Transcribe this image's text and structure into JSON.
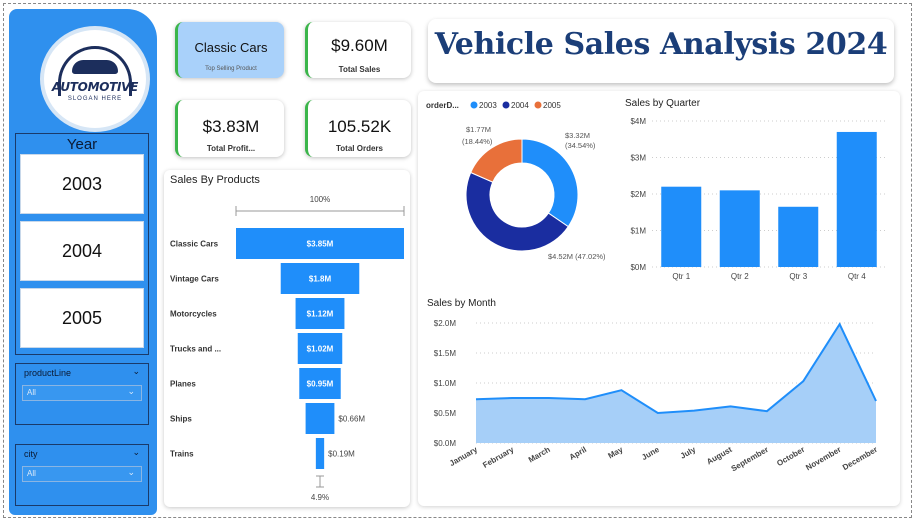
{
  "sidebar": {
    "logo": {
      "name": "AUTOMOTIVE",
      "slogan": "SLOGAN HERE"
    },
    "year_slicer": {
      "title": "Year",
      "options": [
        "2003",
        "2004",
        "2005"
      ]
    },
    "product_slicer": {
      "label": "productLine",
      "value": "All"
    },
    "city_slicer": {
      "label": "city",
      "value": "All"
    }
  },
  "kpis": {
    "top_product": {
      "value": "Classic Cars",
      "label": "Top Selling Product"
    },
    "total_sales": {
      "value": "$9.60M",
      "label": "Total Sales"
    },
    "total_profit": {
      "value": "$3.83M",
      "label": "Total Profit..."
    },
    "total_orders": {
      "value": "105.52K",
      "label": "Total Orders"
    }
  },
  "report": {
    "title": "Vehicle Sales Analysis 2024"
  },
  "colors": {
    "primary": "#1f8efa",
    "navy": "#1a2da0",
    "orange": "#e8703a",
    "area": "#a6cff8"
  },
  "chart_data": [
    {
      "type": "bar",
      "subtype": "funnel",
      "title": "Sales By Products",
      "top_label": "100%",
      "bottom_label": "4.9%",
      "categories": [
        "Classic Cars",
        "Vintage Cars",
        "Motorcycles",
        "Trucks and ...",
        "Planes",
        "Ships",
        "Trains"
      ],
      "values": [
        3.85,
        1.8,
        1.12,
        1.02,
        0.95,
        0.66,
        0.19
      ],
      "labels": [
        "$3.85M",
        "$1.8M",
        "$1.12M",
        "$1.02M",
        "$0.95M",
        "$0.66M",
        "$0.19M"
      ]
    },
    {
      "type": "pie",
      "subtype": "donut",
      "legend_title": "orderD...",
      "categories": [
        "2003",
        "2004",
        "2005"
      ],
      "values": [
        3.32,
        4.52,
        1.77
      ],
      "labels": [
        {
          "value": "$3.32M",
          "pct": "(34.54%)"
        },
        {
          "value": "$4.52M (47.02%)",
          "pct": ""
        },
        {
          "value": "$1.77M",
          "pct": "(18.44%)"
        }
      ],
      "colors": [
        "#1f8efa",
        "#1a2da0",
        "#e8703a"
      ]
    },
    {
      "type": "bar",
      "title": "Sales by Quarter",
      "categories": [
        "Qtr 1",
        "Qtr 2",
        "Qtr 3",
        "Qtr 4"
      ],
      "values": [
        2.2,
        2.1,
        1.65,
        3.7
      ],
      "ylim": [
        0,
        4
      ],
      "yticks": [
        "$0M",
        "$1M",
        "$2M",
        "$3M",
        "$4M"
      ]
    },
    {
      "type": "area",
      "title": "Sales by Month",
      "categories": [
        "January",
        "February",
        "March",
        "April",
        "May",
        "June",
        "July",
        "August",
        "September",
        "October",
        "November",
        "December"
      ],
      "values": [
        0.73,
        0.75,
        0.75,
        0.73,
        0.88,
        0.5,
        0.54,
        0.61,
        0.53,
        1.03,
        1.98,
        0.7
      ],
      "ylim": [
        0,
        2
      ],
      "yticks": [
        "$0.0M",
        "$0.5M",
        "$1.0M",
        "$1.5M",
        "$2.0M"
      ]
    }
  ]
}
